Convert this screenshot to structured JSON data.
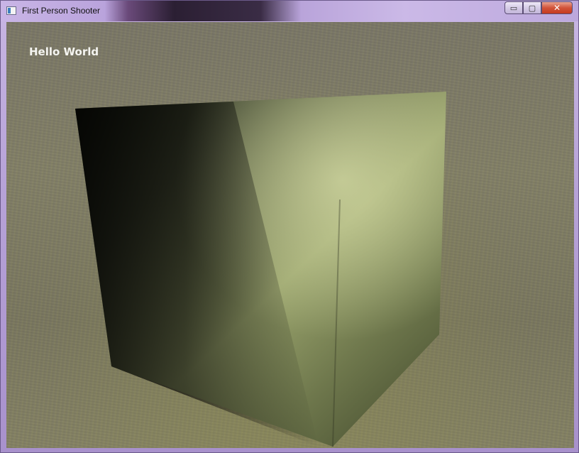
{
  "window": {
    "title": "First Person Shooter",
    "controls": {
      "minimize": "▭",
      "maximize": "▢",
      "close": "✕"
    }
  },
  "hud": {
    "text": "Hello World"
  },
  "scene": {
    "ground_color": "#807c6a",
    "cube_front_color": "#8c9463",
    "cube_side_color": "#1a1d12"
  }
}
